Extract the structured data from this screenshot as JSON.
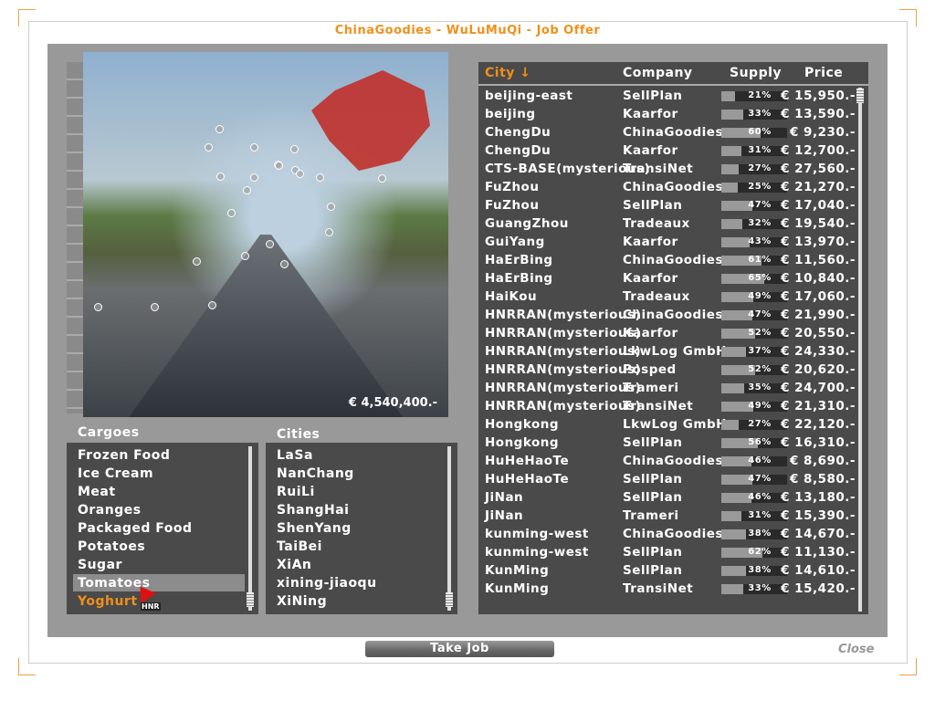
{
  "window": {
    "title": "ChinaGoodies - WuLuMuQi - Job Offer"
  },
  "preview": {
    "cash": "€ 4,540,400.-"
  },
  "cargoes": {
    "label": "Cargoes",
    "items": [
      "Frozen Food",
      "Ice Cream",
      "Meat",
      "Oranges",
      "Packaged Food",
      "Potatoes",
      "Sugar",
      "Tomatoes",
      "Yoghurt"
    ],
    "selected": "Tomatoes",
    "highlighted": "Yoghurt"
  },
  "cities": {
    "label": "Cities",
    "items": [
      "LaSa",
      "NanChang",
      "RuiLi",
      "ShangHai",
      "ShenYang",
      "TaiBei",
      "XiAn",
      "xining-jiaoqu",
      "XiNing"
    ]
  },
  "table": {
    "headers": {
      "city": "City ↓",
      "company": "Company",
      "supply": "Supply",
      "price": "Price"
    },
    "rows": [
      {
        "city": "beijing-east",
        "company": "SellPlan",
        "supply": "21%",
        "price": "€ 15,950.-"
      },
      {
        "city": "beijing",
        "company": "Kaarfor",
        "supply": "33%",
        "price": "€ 13,590.-"
      },
      {
        "city": "ChengDu",
        "company": "ChinaGoodies",
        "supply": "60%",
        "price": "€ 9,230.-"
      },
      {
        "city": "ChengDu",
        "company": "Kaarfor",
        "supply": "31%",
        "price": "€ 12,700.-"
      },
      {
        "city": "CTS-BASE(mysterious)",
        "company": "TransiNet",
        "supply": "27%",
        "price": "€ 27,560.-"
      },
      {
        "city": "FuZhou",
        "company": "ChinaGoodies",
        "supply": "25%",
        "price": "€ 21,270.-"
      },
      {
        "city": "FuZhou",
        "company": "SellPlan",
        "supply": "47%",
        "price": "€ 17,040.-"
      },
      {
        "city": "GuangZhou",
        "company": "Tradeaux",
        "supply": "32%",
        "price": "€ 19,540.-"
      },
      {
        "city": "GuiYang",
        "company": "Kaarfor",
        "supply": "43%",
        "price": "€ 13,970.-"
      },
      {
        "city": "HaErBing",
        "company": "ChinaGoodies",
        "supply": "61%",
        "price": "€ 11,560.-"
      },
      {
        "city": "HaErBing",
        "company": "Kaarfor",
        "supply": "65%",
        "price": "€ 10,840.-"
      },
      {
        "city": "HaiKou",
        "company": "Tradeaux",
        "supply": "49%",
        "price": "€ 17,060.-"
      },
      {
        "city": "HNRRAN(mysterious)",
        "company": "ChinaGoodies",
        "supply": "47%",
        "price": "€ 21,990.-"
      },
      {
        "city": "HNRRAN(mysterious)",
        "company": "Kaarfor",
        "supply": "52%",
        "price": "€ 20,550.-"
      },
      {
        "city": "HNRRAN(mysterious)",
        "company": "LkwLog GmbH",
        "supply": "37%",
        "price": "€ 24,330.-"
      },
      {
        "city": "HNRRAN(mysterious)",
        "company": "Posped",
        "supply": "52%",
        "price": "€ 20,620.-"
      },
      {
        "city": "HNRRAN(mysterious)",
        "company": "Trameri",
        "supply": "35%",
        "price": "€ 24,700.-"
      },
      {
        "city": "HNRRAN(mysterious)",
        "company": "TransiNet",
        "supply": "49%",
        "price": "€ 21,310.-"
      },
      {
        "city": "Hongkong",
        "company": "LkwLog GmbH",
        "supply": "27%",
        "price": "€ 22,120.-"
      },
      {
        "city": "Hongkong",
        "company": "SellPlan",
        "supply": "56%",
        "price": "€ 16,310.-"
      },
      {
        "city": "HuHeHaoTe",
        "company": "ChinaGoodies",
        "supply": "46%",
        "price": "€ 8,690.-"
      },
      {
        "city": "HuHeHaoTe",
        "company": "SellPlan",
        "supply": "47%",
        "price": "€ 8,580.-"
      },
      {
        "city": "JiNan",
        "company": "SellPlan",
        "supply": "46%",
        "price": "€ 13,180.-"
      },
      {
        "city": "JiNan",
        "company": "Trameri",
        "supply": "31%",
        "price": "€ 15,390.-"
      },
      {
        "city": "kunming-west",
        "company": "ChinaGoodies",
        "supply": "38%",
        "price": "€ 14,670.-"
      },
      {
        "city": "kunming-west",
        "company": "SellPlan",
        "supply": "62%",
        "price": "€ 11,130.-"
      },
      {
        "city": "KunMing",
        "company": "SellPlan",
        "supply": "38%",
        "price": "€ 14,610.-"
      },
      {
        "city": "KunMing",
        "company": "TransiNet",
        "supply": "33%",
        "price": "€ 15,420.-"
      }
    ]
  },
  "buttons": {
    "take_job": "Take Job",
    "close": "Close"
  },
  "cursor_label": "HNR",
  "colors": {
    "accent": "#f0901a",
    "panel": "#999999",
    "list_bg": "#4a4a4a"
  }
}
